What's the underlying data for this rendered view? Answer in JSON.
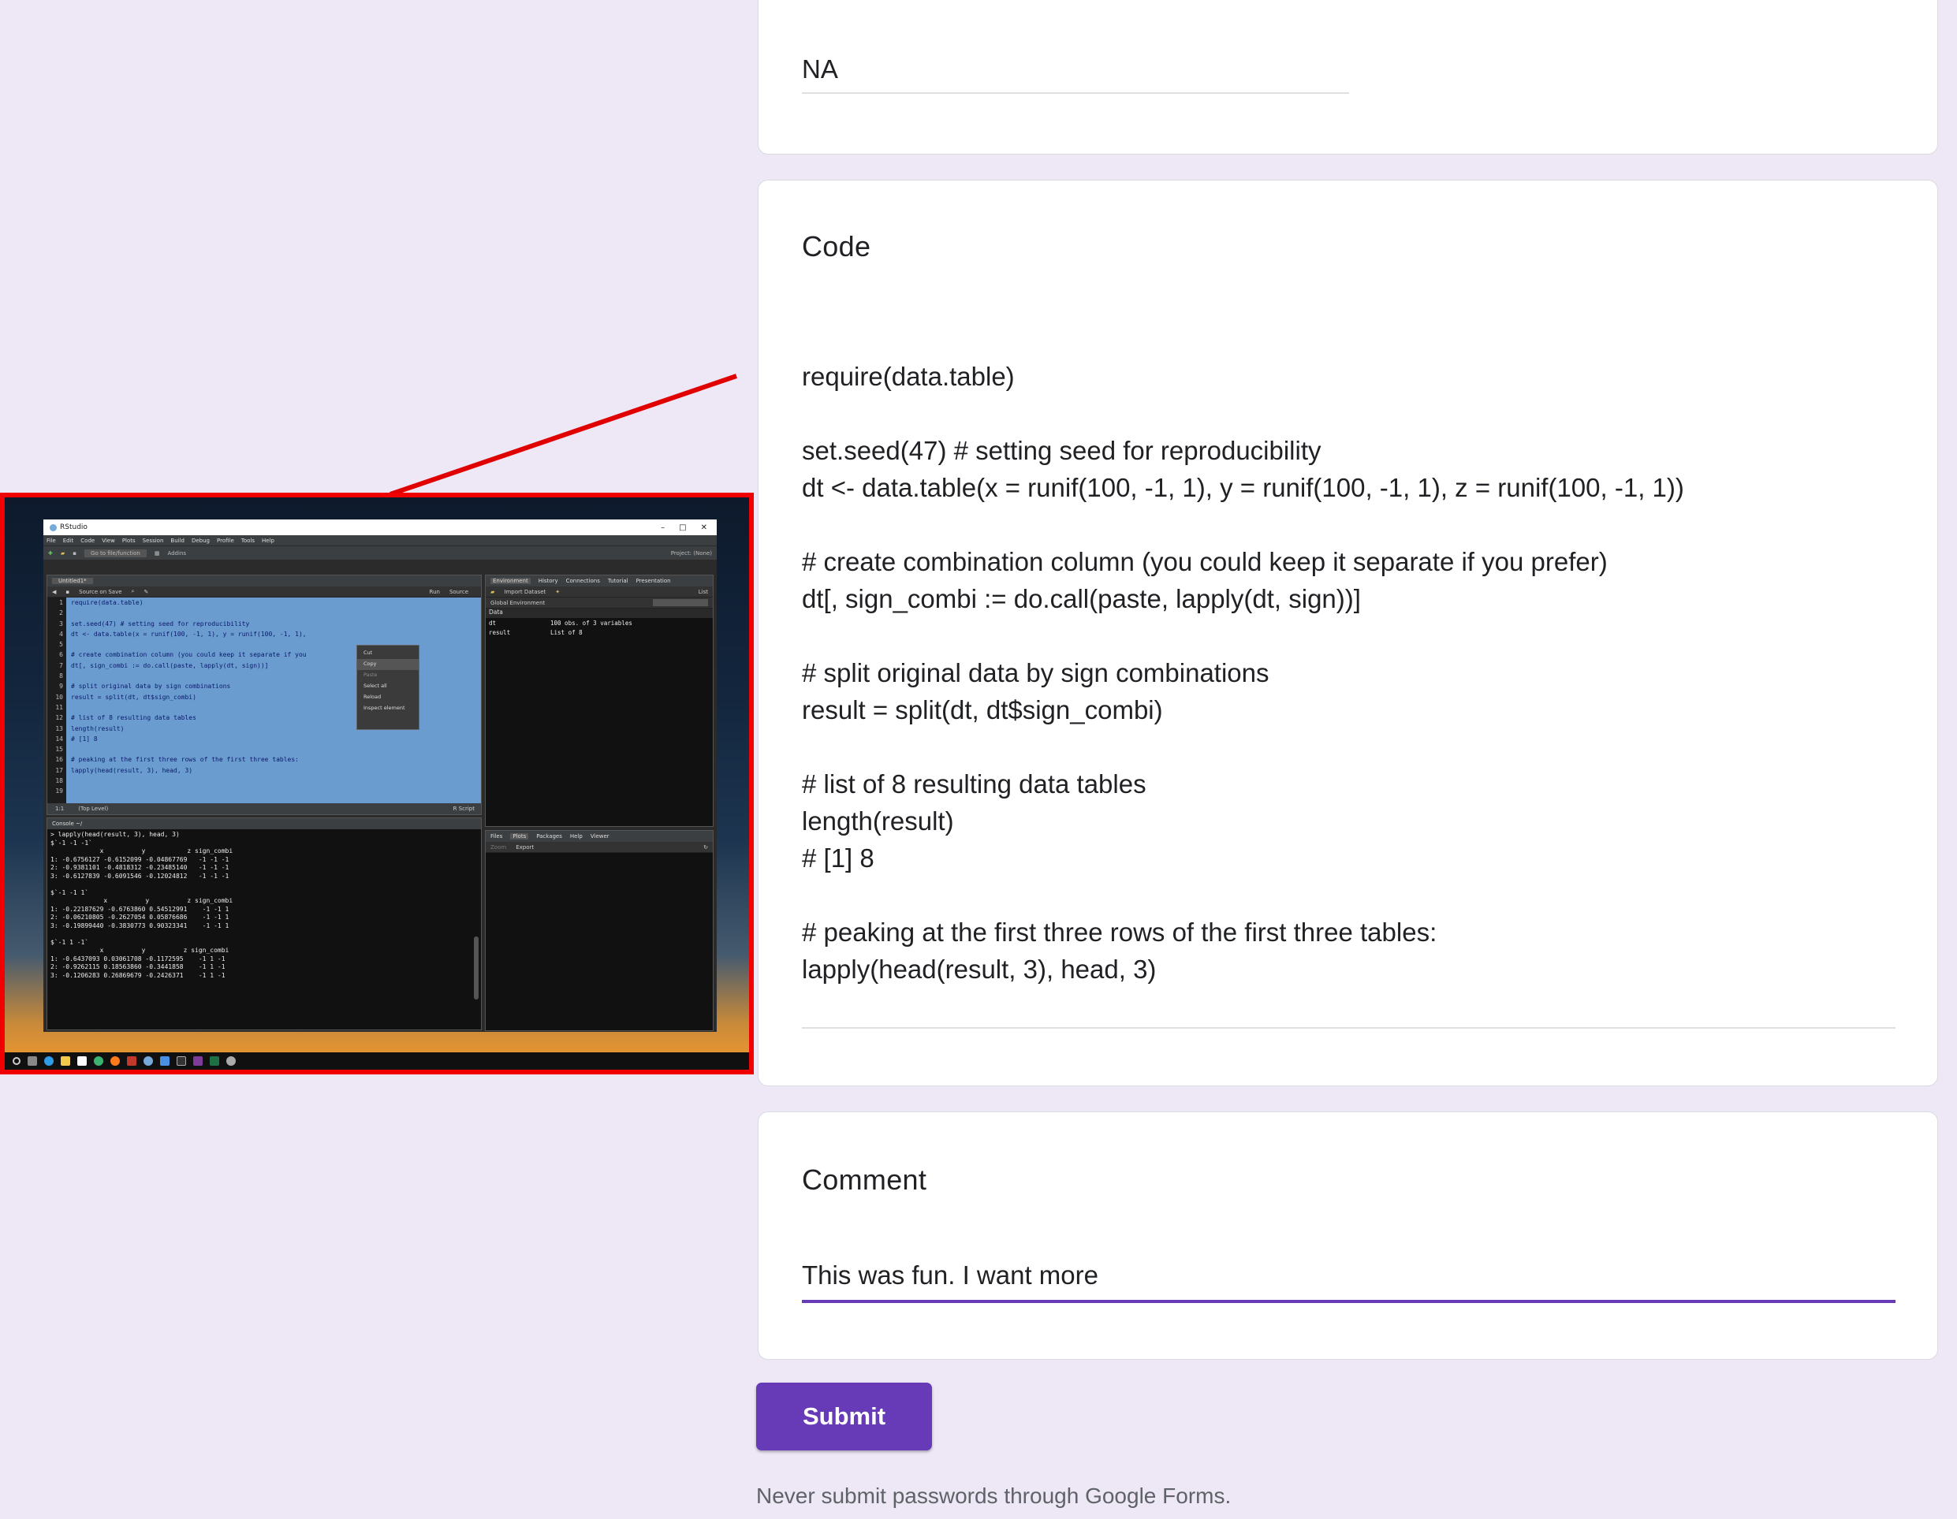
{
  "form": {
    "na_answer": "NA",
    "code_title": "Code",
    "code_answer": "require(data.table)\n\nset.seed(47) # setting seed for reproducibility\ndt <- data.table(x = runif(100, -1, 1), y = runif(100, -1, 1), z = runif(100, -1, 1))\n\n# create combination column (you could keep it separate if you prefer)\ndt[, sign_combi := do.call(paste, lapply(dt, sign))]\n\n# split original data by sign combinations\nresult = split(dt, dt$sign_combi)\n\n# list of 8 resulting data tables\nlength(result)\n# [1] 8\n\n# peaking at the first three rows of the first three tables:\nlapply(head(result, 3), head, 3)",
    "comment_title": "Comment",
    "comment_answer": "This was fun. I want more",
    "submit_label": "Submit",
    "footer_note": "Never submit passwords through Google Forms.",
    "accent_color": "#673ab7"
  },
  "inset": {
    "window_title": "RStudio",
    "menu": [
      "File",
      "Edit",
      "Code",
      "View",
      "Plots",
      "Session",
      "Build",
      "Debug",
      "Profile",
      "Tools",
      "Help"
    ],
    "toolbar": {
      "goto": "Go to file/function",
      "addins": "Addins",
      "project": "Project: (None)"
    },
    "editor": {
      "tab": "Untitled1*",
      "source_on_save": "Source on Save",
      "run": "Run",
      "source": "Source",
      "line_numbers": "1\n2\n3\n4\n5\n6\n7\n8\n9\n10\n11\n12\n13\n14\n15\n16\n17\n18\n19",
      "code": "require(data.table)\n\nset.seed(47) # setting seed for reproducibility\ndt <- data.table(x = runif(100, -1, 1), y = runif(100, -1, 1),\n\n# create combination column (you could keep it separate if you\ndt[, sign_combi := do.call(paste, lapply(dt, sign))]\n\n# split original data by sign combinations\nresult = split(dt, dt$sign_combi)\n\n# list of 8 resulting data tables\nlength(result)\n# [1] 8\n\n# peaking at the first three rows of the first three tables:\nlapply(head(result, 3), head, 3)\n",
      "status_pos": "1:1",
      "status_level": "(Top Level)",
      "status_type": "R Script"
    },
    "context_menu": [
      "Cut",
      "Copy",
      "Paste",
      "Select all",
      "Reload",
      "Inspect element"
    ],
    "console": {
      "tab": "Console ~/",
      "output": "> lapply(head(result, 3), head, 3)\n$`-1 -1 -1`\n             x          y           z sign_combi\n1: -0.6756127 -0.6152099 -0.04867769   -1 -1 -1\n2: -0.9381101 -0.4818312 -0.23485140   -1 -1 -1\n3: -0.6127839 -0.6091546 -0.12024812   -1 -1 -1\n\n$`-1 -1 1`\n              x          y          z sign_combi\n1: -0.22187629 -0.6763860 0.54512991    -1 -1 1\n2: -0.06210805 -0.2627054 0.05876686    -1 -1 1\n3: -0.19899440 -0.3830773 0.90323341    -1 -1 1\n\n$`-1 1 -1`\n             x          y          z sign_combi\n1: -0.6437093 0.03061708 -0.1172595    -1 1 -1\n2: -0.9262115 0.18563860 -0.3441858    -1 1 -1\n3: -0.1206283 0.26869679 -0.2426371    -1 1 -1"
    },
    "env": {
      "tabs": [
        "Environment",
        "History",
        "Connections",
        "Tutorial",
        "Presentation"
      ],
      "import": "Import Dataset",
      "list": "List",
      "scope": "Global Environment",
      "section": "Data",
      "rows": [
        {
          "name": "dt",
          "value": "100 obs. of 3 variables"
        },
        {
          "name": "result",
          "value": "List of 8"
        }
      ]
    },
    "files": {
      "tabs": [
        "Files",
        "Plots",
        "Packages",
        "Help",
        "Viewer"
      ],
      "zoom": "Zoom",
      "export": "Export"
    }
  }
}
